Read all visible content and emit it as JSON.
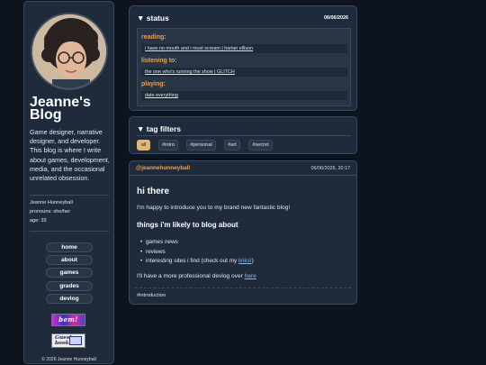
{
  "sidebar": {
    "title": "Jeanne's Blog",
    "bio": "Game designer, narrative designer, and developer. This blog is where I write about games, development, media, and the occasional unrelated obsession.",
    "name": "Jeanne Hunneyball",
    "pronouns": "pronouns: she/her",
    "age": "age: 33",
    "nav": [
      "home",
      "about",
      "games",
      "grades",
      "devlog"
    ],
    "badge_1_text": "bem!",
    "badge_2_text": "Guest book",
    "copyright": "© 2026 Jeanne Hunneyball"
  },
  "status": {
    "heading": "▼ status",
    "date": "06/06/2026",
    "reading_label": "reading:",
    "reading_value": "i have no mouth and i must scream  |  harlan ellison",
    "listening_label": "listening to:",
    "listening_value": "the one who's running the show  |  GLITCH",
    "playing_label": "playing:",
    "playing_value": "date everything"
  },
  "tags": {
    "heading": "▼ tag filters",
    "items": [
      "all",
      "#intro",
      "#personal",
      "#art",
      "#secret"
    ],
    "active": "all"
  },
  "post": {
    "author": "@jeannehunneyball",
    "date": "06/06/2026, 20:17",
    "title": "hi there",
    "intro": "I'm happy to introduce you to my brand new fantastic blog!",
    "subheading": "things i'm likely to blog about",
    "list": [
      "games news",
      "reviews",
      "interesting sites i find (check out my "
    ],
    "list_link": "links!",
    "closing": "I'll have a more professional devlog over ",
    "closing_link": "here",
    "tag": "#introduction"
  },
  "colors": {
    "background": "#0d141d",
    "panel": "#1f2b3a",
    "accent": "#e8a25a",
    "link": "#8fb6e8"
  }
}
